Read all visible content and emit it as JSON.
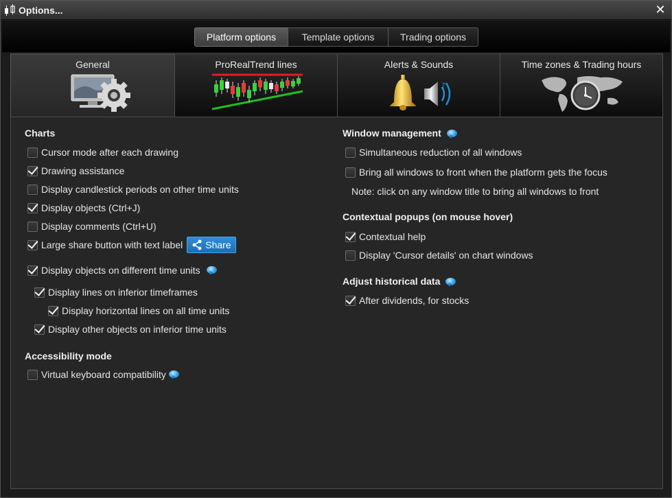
{
  "window": {
    "title": "Options..."
  },
  "top_tabs": [
    {
      "label": "Platform options",
      "active": true
    },
    {
      "label": "Template options",
      "active": false
    },
    {
      "label": "Trading options",
      "active": false
    }
  ],
  "tabs": [
    {
      "label": "General",
      "icon": "monitor-gear-icon",
      "active": true
    },
    {
      "label": "ProRealTrend lines",
      "icon": "trend-chart-icon",
      "active": false
    },
    {
      "label": "Alerts & Sounds",
      "icon": "bell-speaker-icon",
      "active": false
    },
    {
      "label": "Time zones & Trading hours",
      "icon": "world-clock-icon",
      "active": false
    }
  ],
  "left": {
    "charts": {
      "title": "Charts",
      "options": [
        {
          "label": "Cursor mode after each drawing",
          "checked": false
        },
        {
          "label": "Drawing assistance",
          "checked": true
        },
        {
          "label": "Display candlestick periods on other time units",
          "checked": false
        },
        {
          "label": "Display objects (Ctrl+J)",
          "checked": true
        },
        {
          "label": "Display comments (Ctrl+U)",
          "checked": false
        },
        {
          "label": "Large share button with text label",
          "checked": true
        },
        {
          "label": "Display objects on different time units",
          "checked": true
        },
        {
          "label": "Display lines on inferior timeframes",
          "checked": true
        },
        {
          "label": "Display horizontal lines on all time units",
          "checked": true
        },
        {
          "label": "Display other objects on inferior time units",
          "checked": true
        }
      ],
      "share_button_label": "Share"
    },
    "accessibility": {
      "title": "Accessibility mode",
      "options": [
        {
          "label": "Virtual keyboard compatibility",
          "checked": false
        }
      ]
    }
  },
  "right": {
    "window_management": {
      "title": "Window management",
      "options": [
        {
          "label": "Simultaneous reduction of all windows",
          "checked": false
        },
        {
          "label": "Bring all windows to front when the platform gets the focus",
          "checked": false
        }
      ],
      "note": "Note: click on any window title to bring all windows to front"
    },
    "contextual_popups": {
      "title": "Contextual popups (on mouse hover)",
      "options": [
        {
          "label": "Contextual help",
          "checked": true
        },
        {
          "label": "Display 'Cursor details' on chart windows",
          "checked": false
        }
      ]
    },
    "historical_data": {
      "title": "Adjust historical data",
      "options": [
        {
          "label": "After dividends, for stocks",
          "checked": true
        }
      ]
    }
  },
  "colors": {
    "accent": "#2a8fd8",
    "background": "#262626",
    "text": "#e6e6e6"
  }
}
